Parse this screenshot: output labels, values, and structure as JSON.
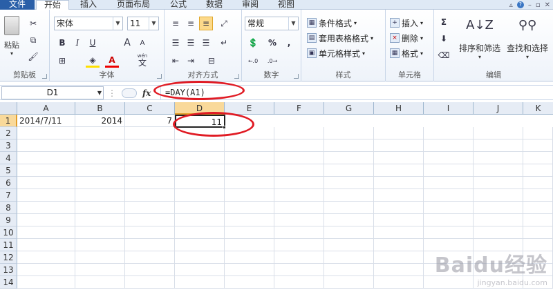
{
  "tabs": [
    "文件",
    "开始",
    "插入",
    "页面布局",
    "公式",
    "数据",
    "审阅",
    "视图"
  ],
  "clipboard": {
    "paste": "粘贴",
    "label": "剪贴板"
  },
  "font": {
    "name": "宋体",
    "size": "11",
    "label": "字体",
    "bold": "B",
    "italic": "I",
    "underline": "U",
    "grow": "A",
    "shrink": "A",
    "color_a": "A",
    "wen": "wén",
    "zi": "文"
  },
  "align": {
    "label": "对齐方式"
  },
  "number": {
    "format": "常规",
    "label": "数字",
    "percent": "%",
    "comma": ","
  },
  "styles": {
    "cond": "条件格式",
    "table": "套用表格格式",
    "cell": "单元格样式",
    "label": "样式"
  },
  "cells": {
    "insert": "插入",
    "delete": "删除",
    "format": "格式",
    "label": "单元格"
  },
  "edit": {
    "sigma": "Σ",
    "sort": "排序和筛选",
    "find": "查找和选择",
    "label": "编辑"
  },
  "formula_bar": {
    "name_box": "D1",
    "fx": "fx",
    "formula": "=DAY(A1)"
  },
  "columns": [
    "A",
    "B",
    "C",
    "D",
    "E",
    "F",
    "G",
    "H",
    "I",
    "J",
    "K"
  ],
  "rows": [
    "1",
    "2",
    "3",
    "4",
    "5",
    "6",
    "7",
    "8",
    "9",
    "10",
    "11",
    "12",
    "13",
    "14"
  ],
  "row1": {
    "A": "2014/7/11",
    "B": "2014",
    "C": "7",
    "D": "11"
  },
  "colors": {
    "selection": "#f9d99a",
    "annotation": "#e01b24",
    "file_tab": "#2a5fa8"
  },
  "watermark": {
    "big": "Baidu经验",
    "small": "jingyan.baidu.com"
  }
}
